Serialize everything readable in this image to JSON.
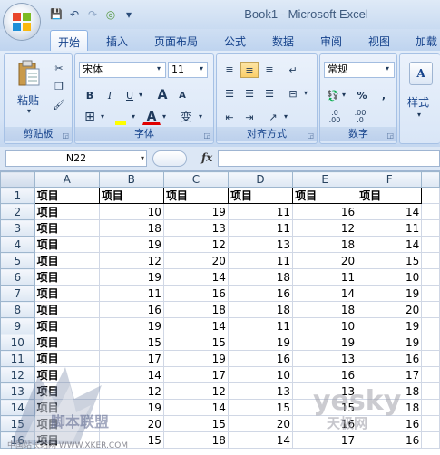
{
  "app": {
    "title": "Book1 - Microsoft Excel",
    "quick_access": {
      "save": "💾",
      "undo": "↶",
      "redo": "↷",
      "custom": "◎",
      "menu": "▾"
    }
  },
  "tabs": [
    "开始",
    "插入",
    "页面布局",
    "公式",
    "数据",
    "审阅",
    "视图",
    "加载项"
  ],
  "active_tab": "开始",
  "ribbon": {
    "clipboard": {
      "label": "剪贴板",
      "paste": "粘贴",
      "cut_icon": "scissors-icon",
      "copy_icon": "copy-icon",
      "painter_icon": "format-painter-icon"
    },
    "font": {
      "label": "字体",
      "font_name": "宋体",
      "font_size": "11",
      "bold": "B",
      "italic": "I",
      "underline": "U",
      "grow": "A",
      "shrink": "A",
      "border_icon": "border-icon",
      "fill_icon": "fill-icon",
      "color": "A",
      "phonetic": "变"
    },
    "alignment": {
      "label": "对齐方式"
    },
    "number": {
      "label": "数字",
      "format": "常规",
      "percent": "%",
      "comma": ",",
      "inc_decimal": ".0 .00",
      "dec_decimal": ".00 .0"
    },
    "styles": {
      "label": "样式"
    }
  },
  "formula_bar": {
    "name_box": "N22",
    "fx": "fx",
    "content": ""
  },
  "columns": [
    "A",
    "B",
    "C",
    "D",
    "E",
    "F"
  ],
  "rows": [
    {
      "n": "1",
      "cells": [
        "项目",
        "项目",
        "项目",
        "项目",
        "项目",
        "项目"
      ]
    },
    {
      "n": "2",
      "cells": [
        "项目",
        "10",
        "19",
        "11",
        "16",
        "14"
      ]
    },
    {
      "n": "3",
      "cells": [
        "项目",
        "18",
        "13",
        "11",
        "12",
        "11"
      ]
    },
    {
      "n": "4",
      "cells": [
        "项目",
        "19",
        "12",
        "13",
        "18",
        "14"
      ]
    },
    {
      "n": "5",
      "cells": [
        "项目",
        "12",
        "20",
        "11",
        "20",
        "15"
      ]
    },
    {
      "n": "6",
      "cells": [
        "项目",
        "19",
        "14",
        "18",
        "11",
        "10"
      ]
    },
    {
      "n": "7",
      "cells": [
        "项目",
        "11",
        "16",
        "16",
        "14",
        "19"
      ]
    },
    {
      "n": "8",
      "cells": [
        "项目",
        "16",
        "18",
        "18",
        "18",
        "20"
      ]
    },
    {
      "n": "9",
      "cells": [
        "项目",
        "19",
        "14",
        "11",
        "10",
        "19"
      ]
    },
    {
      "n": "10",
      "cells": [
        "项目",
        "15",
        "15",
        "19",
        "19",
        "19"
      ]
    },
    {
      "n": "11",
      "cells": [
        "项目",
        "17",
        "19",
        "16",
        "13",
        "16"
      ]
    },
    {
      "n": "12",
      "cells": [
        "项目",
        "14",
        "17",
        "10",
        "16",
        "17"
      ]
    },
    {
      "n": "13",
      "cells": [
        "项目",
        "12",
        "12",
        "13",
        "13",
        "18"
      ]
    },
    {
      "n": "14",
      "cells": [
        "项目",
        "19",
        "14",
        "15",
        "15",
        "18"
      ]
    },
    {
      "n": "15",
      "cells": [
        "项目",
        "20",
        "15",
        "20",
        "16",
        "16"
      ]
    },
    {
      "n": "16",
      "cells": [
        "项目",
        "15",
        "18",
        "14",
        "17",
        "16"
      ]
    }
  ],
  "watermarks": {
    "left": "脚本联盟",
    "url": "中国站长站网 WWW.XKER.COM",
    "right": "yesky",
    "right2": "天极网"
  },
  "colors": {
    "accent": "#15428b",
    "ribbon_bg": "#d6e4f6",
    "pressed": "#fbcf6a",
    "grid_line": "#d0d7e5"
  }
}
